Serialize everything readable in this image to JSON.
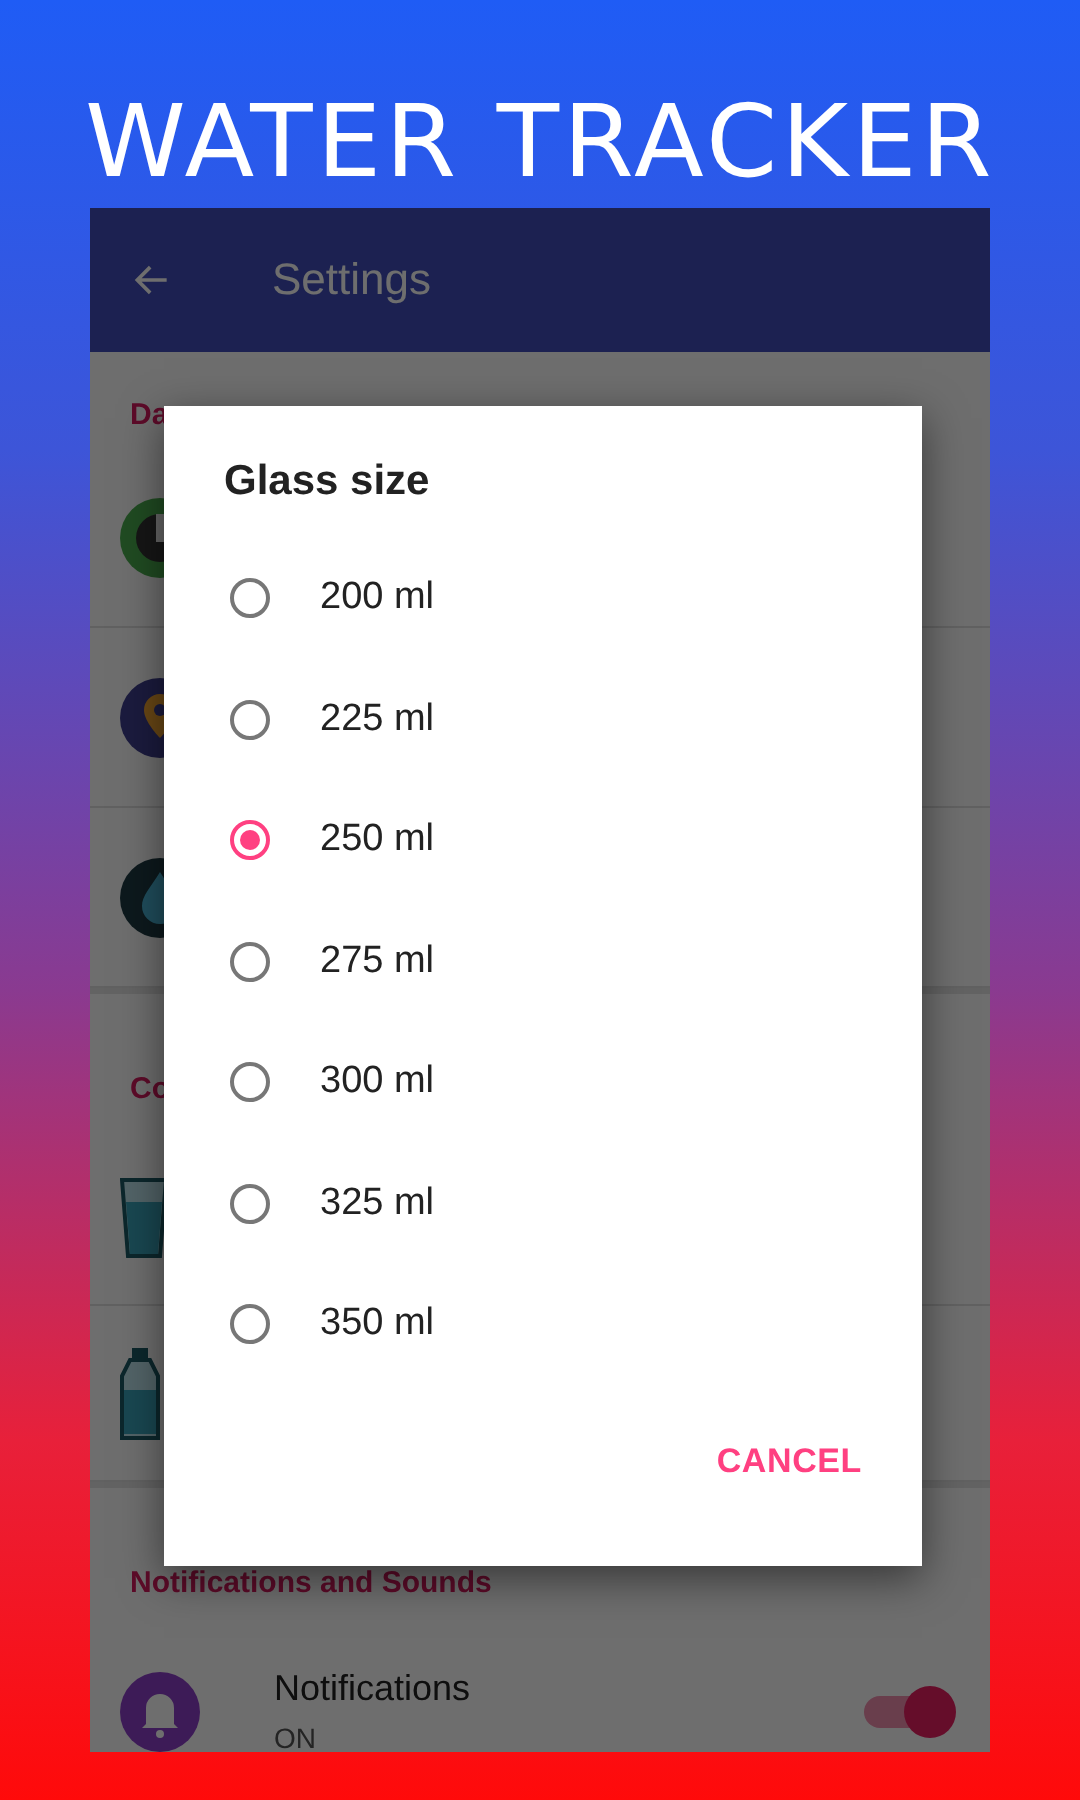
{
  "banner": {
    "title": "WATER TRACKER"
  },
  "app_bar": {
    "title": "Settings"
  },
  "sections": [
    {
      "header": "Da",
      "rows": [
        {
          "kind": "target"
        },
        {
          "kind": "pin"
        },
        {
          "kind": "drop"
        }
      ]
    },
    {
      "header": "Co",
      "rows": [
        {
          "kind": "glass"
        },
        {
          "kind": "bottle"
        }
      ]
    },
    {
      "header": "Notifications and Sounds",
      "rows": [
        {
          "kind": "bell",
          "title": "Notifications",
          "subtitle": "ON",
          "on": true
        }
      ]
    }
  ],
  "dialog": {
    "title": "Glass size",
    "options": [
      {
        "label": "200 ml",
        "selected": false
      },
      {
        "label": "225 ml",
        "selected": false
      },
      {
        "label": "250 ml",
        "selected": true
      },
      {
        "label": "275 ml",
        "selected": false
      },
      {
        "label": "300 ml",
        "selected": false
      },
      {
        "label": "325 ml",
        "selected": false
      },
      {
        "label": "350 ml",
        "selected": false
      }
    ],
    "cancel": "CANCEL"
  }
}
